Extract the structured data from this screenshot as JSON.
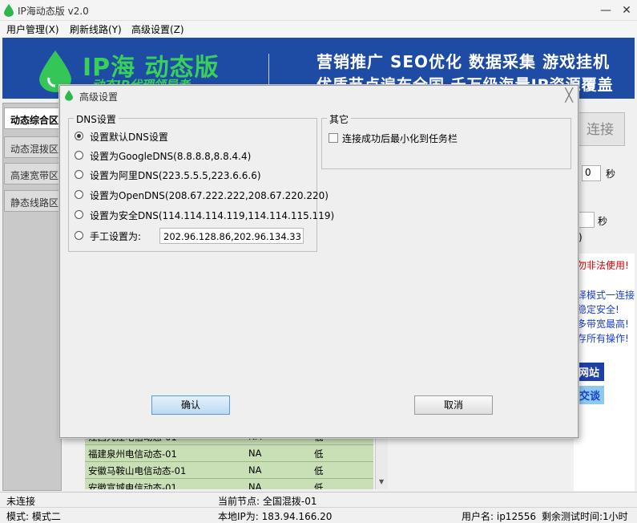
{
  "window": {
    "title": "IP海动态版 v2.0",
    "minimize": "—",
    "close": "✕"
  },
  "menu": {
    "user": "用户管理(X)",
    "refresh": "刷新线路(Y)",
    "advanced": "高级设置(Z)"
  },
  "banner": {
    "logo": "IP海 动态版",
    "sub": "动态IP代理领导者",
    "slogan1": "营销推广  SEO优化  数据采集  游戏挂机",
    "slogan2": "优质节点遍布全国 千万级海量IP资源覆盖"
  },
  "sidebar": {
    "tabs": [
      "动态综合区",
      "动态混拨区",
      "高速宽带区",
      "静态线路区"
    ]
  },
  "right": {
    "connect": "连接",
    "val1": "0",
    "unit1": "秒",
    "unit2": "秒",
    "paren": ")",
    "warning": "勿非法使用!",
    "lines": [
      "译模式一连接",
      "稳定安全!",
      "多带宽最高!",
      "存所有操作!"
    ],
    "site_btn": "网站",
    "talk_btn": "交谈"
  },
  "list": {
    "rows": [
      {
        "name": "江西九江电信动态-01",
        "status": "NA",
        "level": "低"
      },
      {
        "name": "福建泉州电信动态-01",
        "status": "NA",
        "level": "低"
      },
      {
        "name": "安徽马鞍山电信动态-01",
        "status": "NA",
        "level": "低"
      },
      {
        "name": "安徽宣城电信动态-01",
        "status": "NA",
        "level": "低"
      }
    ]
  },
  "status": {
    "conn": "未连接",
    "node": "当前节点: 全国混拨-01",
    "mode": "模式: 模式二",
    "local_ip": "本地IP为: 183.94.166.20",
    "user": "用户名: ip12556",
    "remain": "剩余测试时间:1小时"
  },
  "dialog": {
    "title": "高级设置",
    "dns_group": "DNS设置",
    "options": [
      {
        "label": "设置默认DNS设置",
        "selected": true
      },
      {
        "label": "设置为GoogleDNS(8.8.8.8,8.8.4.4)",
        "selected": false
      },
      {
        "label": "设置为阿里DNS(223.5.5.5,223.6.6.6)",
        "selected": false
      },
      {
        "label": "设置为OpenDNS(208.67.222.222,208.67.220.220)",
        "selected": false
      },
      {
        "label": "设置为安全DNS(114.114.114.119,114.114.115.119)",
        "selected": false
      },
      {
        "label": "手工设置为:",
        "selected": false
      }
    ],
    "manual_value": "202.96.128.86,202.96.134.33",
    "other_group": "其它",
    "minimize_label": "连接成功后最小化到任务栏",
    "ok": "确认",
    "cancel": "取消"
  }
}
